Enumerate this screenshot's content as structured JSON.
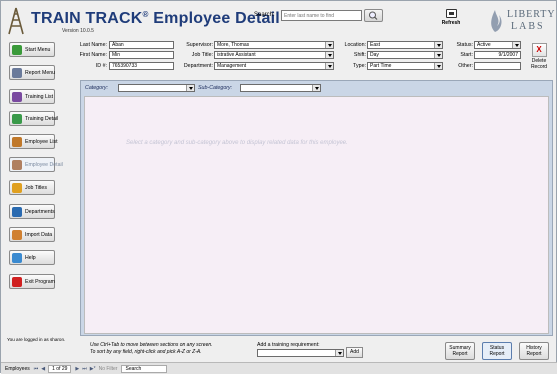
{
  "app": {
    "brand": "TRAIN TRACK",
    "reg": "®",
    "title": "Employee Detail",
    "version": "Version 10.0.5"
  },
  "search": {
    "label": "Search:",
    "placeholder": "Enter last name to find"
  },
  "refresh_label": "Refresh",
  "liberty": {
    "line1": "LIBERTY",
    "line2": "LABS"
  },
  "nav": [
    {
      "label": "Start Menu",
      "icon": "start-menu-icon",
      "color": "#3a9a3a"
    },
    {
      "label": "Report Menu",
      "icon": "report-menu-icon",
      "color": "#6a7a9a"
    },
    {
      "label": "Training List",
      "icon": "training-list-icon",
      "color": "#7a4aa0"
    },
    {
      "label": "Training Detail",
      "icon": "training-detail-icon",
      "color": "#3a9a4a"
    },
    {
      "label": "Employee List",
      "icon": "employee-list-icon",
      "color": "#c0782a"
    },
    {
      "label": "Employee Detail",
      "icon": "employee-detail-icon",
      "color": "#b08060"
    },
    {
      "label": "Job Titles",
      "icon": "job-titles-icon",
      "color": "#e0a020"
    },
    {
      "label": "Departments",
      "icon": "departments-icon",
      "color": "#2a6ab0"
    },
    {
      "label": "Import Data",
      "icon": "import-data-icon",
      "color": "#d08030"
    },
    {
      "label": "Help",
      "icon": "help-icon",
      "color": "#3a8ad0"
    },
    {
      "label": "Exit Program",
      "icon": "exit-program-icon",
      "color": "#d02020"
    }
  ],
  "form": {
    "last_name": {
      "label": "Last Name:",
      "value": "Aban"
    },
    "first_name": {
      "label": "First Name:",
      "value": "Min"
    },
    "id": {
      "label": "ID #:",
      "value": "765390733"
    },
    "supervisor": {
      "label": "Supervisor:",
      "value": "More, Thomas"
    },
    "job_title": {
      "label": "Job Title:",
      "value": "istrative Assistant"
    },
    "department": {
      "label": "Department:",
      "value": "Management"
    },
    "location": {
      "label": "Location:",
      "value": "East"
    },
    "shift": {
      "label": "Shift:",
      "value": "Day"
    },
    "type": {
      "label": "Type:",
      "value": "Part Time"
    },
    "status": {
      "label": "Status:",
      "value": "Active"
    },
    "start": {
      "label": "Start:",
      "value": "9/1/2007"
    },
    "other": {
      "label": "Other:",
      "value": ""
    }
  },
  "delete": {
    "x": "X",
    "line1": "Delete",
    "line2": "Record"
  },
  "category": {
    "label": "Category:",
    "value": ""
  },
  "subcategory": {
    "label": "Sub-Category:",
    "value": ""
  },
  "placeholder_text": "Select a category and sub-category above to display related data for this employee.",
  "logged_in": "You are logged in as sharon.",
  "hints": {
    "line1": "Use Ctrl+Tab to move between sections on any screen.",
    "line2": "To sort by any field, right-click and pick A-Z or Z-A."
  },
  "training_req": {
    "label": "Add a training requirement:",
    "value": "",
    "button": "Add"
  },
  "reports": [
    {
      "line1": "Summary",
      "line2": "Report"
    },
    {
      "line1": "Status",
      "line2": "Report"
    },
    {
      "line1": "History",
      "line2": "Report"
    }
  ],
  "statusbar": {
    "record_label": "Employees",
    "first": "⏮",
    "prev": "◀",
    "position": "1 of 29",
    "next": "▶",
    "last": "⏭",
    "new": "▶*",
    "filter": "No Filter",
    "search": "Search"
  },
  "colors": {
    "accent": "#1f3c7a",
    "panel": "#cad6e6",
    "content": "#f6eef6"
  }
}
